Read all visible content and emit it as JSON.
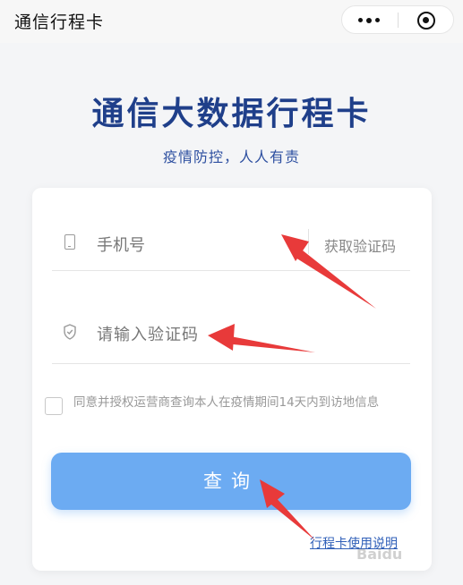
{
  "navbar": {
    "title": "通信行程卡"
  },
  "header": {
    "title": "通信大数据行程卡",
    "subtitle": "疫情防控，人人有责"
  },
  "form": {
    "phone_placeholder": "手机号",
    "get_code_label": "获取验证码",
    "code_placeholder": "请输入验证码",
    "agreement_text": "同意并授权运营商查询本人在疫情期间14天内到访地信息",
    "query_button": "查询",
    "guide_link": "行程卡使用说明"
  },
  "watermark": "Baidu",
  "colors": {
    "title_blue": "#1f3f8a",
    "button_blue": "#6cabf2",
    "annotation_red": "#e83a3a"
  }
}
